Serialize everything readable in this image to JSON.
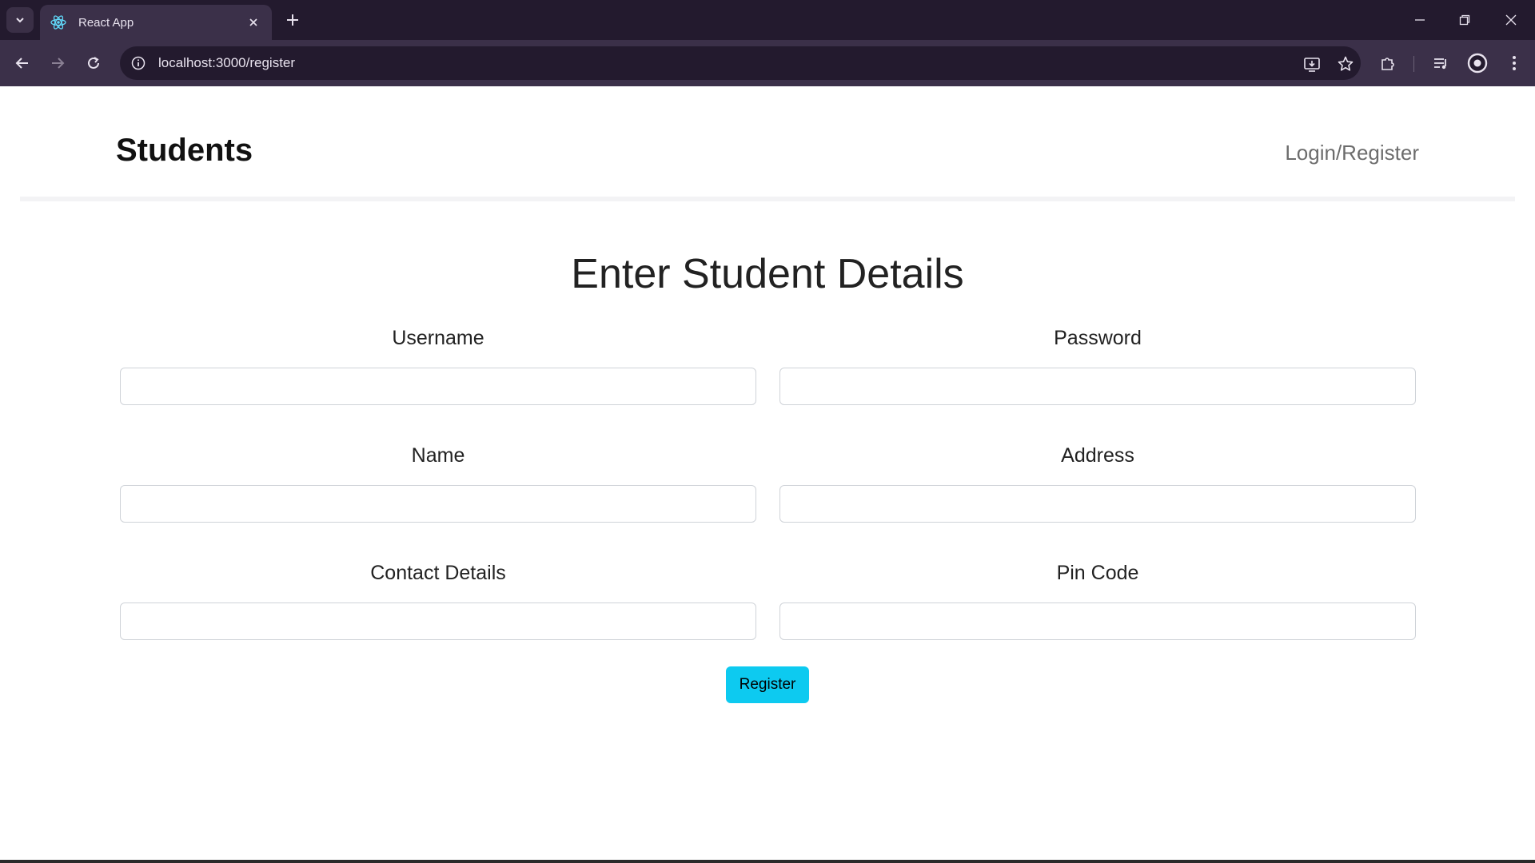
{
  "browser": {
    "tab_title": "React App",
    "url": "localhost:3000/register",
    "favicon": "react-icon"
  },
  "navbar": {
    "brand": "Students",
    "link": "Login/Register"
  },
  "form": {
    "heading": "Enter Student Details",
    "fields": [
      {
        "label": "Username",
        "value": ""
      },
      {
        "label": "Password",
        "value": ""
      },
      {
        "label": "Name",
        "value": ""
      },
      {
        "label": "Address",
        "value": ""
      },
      {
        "label": "Contact Details",
        "value": ""
      },
      {
        "label": "Pin Code",
        "value": ""
      }
    ],
    "submit_label": "Register"
  },
  "colors": {
    "accent": "#0dcaf0",
    "chrome_dark": "#231a2e",
    "chrome_toolbar": "#3b3049"
  }
}
